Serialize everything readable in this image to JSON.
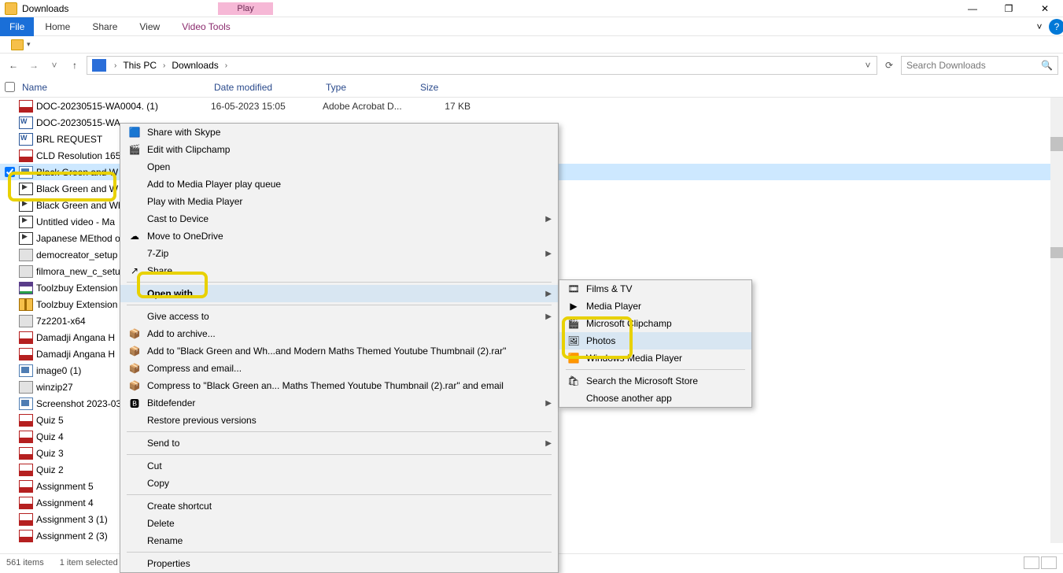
{
  "window": {
    "title": "Downloads",
    "play_tab": "Play",
    "video_tools": "Video Tools"
  },
  "ribbon": {
    "file": "File",
    "home": "Home",
    "share": "Share",
    "view": "View"
  },
  "nav": {
    "crumbs": [
      "This PC",
      "Downloads"
    ],
    "search_placeholder": "Search Downloads"
  },
  "columns": {
    "name": "Name",
    "date": "Date modified",
    "type": "Type",
    "size": "Size"
  },
  "files": [
    {
      "name": "DOC-20230515-WA0004. (1)",
      "date": "16-05-2023 15:05",
      "type": "Adobe Acrobat D...",
      "size": "17 KB",
      "icon": "i-pdf"
    },
    {
      "name": "DOC-20230515-WA",
      "icon": "i-doc"
    },
    {
      "name": "BRL REQUEST",
      "icon": "i-doc"
    },
    {
      "name": "CLD Resolution 165",
      "icon": "i-pdf"
    },
    {
      "name": "Black Green and W",
      "icon": "i-img",
      "selected": true,
      "chk": true
    },
    {
      "name": "Black Green and W",
      "icon": "i-vid"
    },
    {
      "name": "Black Green and Wh",
      "icon": "i-vid"
    },
    {
      "name": "Untitled video - Ma",
      "icon": "i-vid"
    },
    {
      "name": "Japanese MEthod o",
      "icon": "i-vid"
    },
    {
      "name": "democreator_setup",
      "icon": "i-exe"
    },
    {
      "name": "filmora_new_c_setu",
      "icon": "i-exe"
    },
    {
      "name": "Toolzbuy Extension",
      "icon": "i-rar"
    },
    {
      "name": "Toolzbuy Extension",
      "icon": "i-zip"
    },
    {
      "name": "7z2201-x64",
      "icon": "i-exe"
    },
    {
      "name": "Damadji Angana H",
      "icon": "i-pdf"
    },
    {
      "name": "Damadji Angana H",
      "icon": "i-pdf"
    },
    {
      "name": "image0 (1)",
      "icon": "i-img"
    },
    {
      "name": "winzip27",
      "icon": "i-exe"
    },
    {
      "name": "Screenshot 2023-03",
      "icon": "i-img"
    },
    {
      "name": "Quiz 5",
      "icon": "i-pdf"
    },
    {
      "name": "Quiz 4",
      "icon": "i-pdf"
    },
    {
      "name": "Quiz 3",
      "icon": "i-pdf"
    },
    {
      "name": "Quiz 2",
      "icon": "i-pdf"
    },
    {
      "name": "Assignment 5",
      "icon": "i-pdf"
    },
    {
      "name": "Assignment 4",
      "icon": "i-pdf"
    },
    {
      "name": "Assignment 3 (1)",
      "icon": "i-pdf"
    },
    {
      "name": "Assignment 2 (3)",
      "icon": "i-pdf"
    }
  ],
  "ctx1": [
    {
      "t": "item",
      "label": "Share with Skype",
      "icon": "🟦"
    },
    {
      "t": "item",
      "label": "Edit with Clipchamp",
      "icon": "🎬"
    },
    {
      "t": "item",
      "label": "Open"
    },
    {
      "t": "item",
      "label": "Add to Media Player play queue"
    },
    {
      "t": "item",
      "label": "Play with Media Player"
    },
    {
      "t": "item",
      "label": "Cast to Device",
      "arrow": true
    },
    {
      "t": "item",
      "label": "Move to OneDrive",
      "icon": "☁"
    },
    {
      "t": "item",
      "label": "7-Zip",
      "arrow": true
    },
    {
      "t": "item",
      "label": "Share",
      "icon": "↗"
    },
    {
      "t": "sep"
    },
    {
      "t": "item",
      "label": "Open with",
      "arrow": true,
      "bold": true,
      "hover": true
    },
    {
      "t": "sep"
    },
    {
      "t": "item",
      "label": "Give access to",
      "arrow": true
    },
    {
      "t": "item",
      "label": "Add to archive...",
      "icon": "📦"
    },
    {
      "t": "item",
      "label": "Add to \"Black Green and Wh...and Modern Maths Themed Youtube Thumbnail (2).rar\"",
      "icon": "📦"
    },
    {
      "t": "item",
      "label": "Compress and email...",
      "icon": "📦"
    },
    {
      "t": "item",
      "label": "Compress to \"Black Green an... Maths Themed Youtube Thumbnail (2).rar\" and email",
      "icon": "📦"
    },
    {
      "t": "item",
      "label": "Bitdefender",
      "icon": "🅱",
      "arrow": true
    },
    {
      "t": "item",
      "label": "Restore previous versions"
    },
    {
      "t": "sep"
    },
    {
      "t": "item",
      "label": "Send to",
      "arrow": true
    },
    {
      "t": "sep"
    },
    {
      "t": "item",
      "label": "Cut"
    },
    {
      "t": "item",
      "label": "Copy"
    },
    {
      "t": "sep"
    },
    {
      "t": "item",
      "label": "Create shortcut"
    },
    {
      "t": "item",
      "label": "Delete"
    },
    {
      "t": "item",
      "label": "Rename"
    },
    {
      "t": "sep"
    },
    {
      "t": "item",
      "label": "Properties"
    }
  ],
  "ctx2": [
    {
      "t": "item",
      "label": "Films & TV",
      "icon": "🎞"
    },
    {
      "t": "item",
      "label": "Media Player",
      "icon": "▶"
    },
    {
      "t": "item",
      "label": "Microsoft Clipchamp",
      "icon": "🎬"
    },
    {
      "t": "item",
      "label": "Photos",
      "icon": "🖼",
      "hover": true
    },
    {
      "t": "item",
      "label": "Windows Media Player",
      "icon": "🟧"
    },
    {
      "t": "sep"
    },
    {
      "t": "item",
      "label": "Search the Microsoft Store",
      "icon": "🛍"
    },
    {
      "t": "item",
      "label": "Choose another app"
    }
  ],
  "status": {
    "items": "561 items",
    "selected": "1 item selected"
  }
}
